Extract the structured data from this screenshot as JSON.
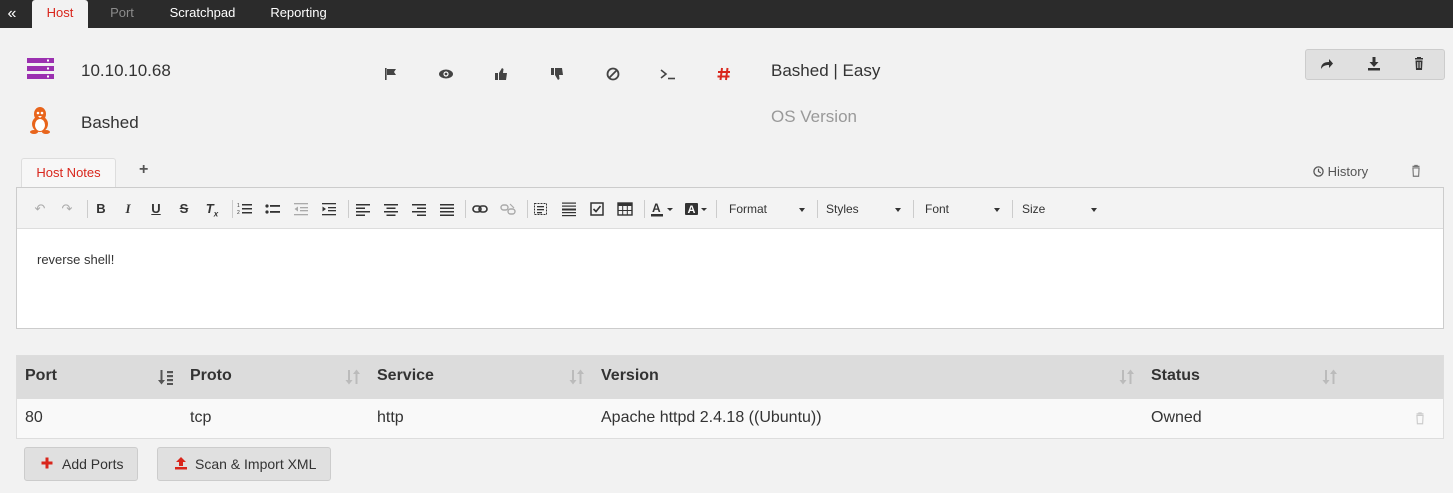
{
  "nav": {
    "back_label": "«",
    "tabs": [
      {
        "label": "Host",
        "active": true
      },
      {
        "label": "Port",
        "active": false
      },
      {
        "label": "Scratchpad",
        "active": false
      },
      {
        "label": "Reporting",
        "active": false
      }
    ]
  },
  "host": {
    "ip": "10.10.10.68",
    "hostname": "Bashed",
    "title": "Bashed | Easy",
    "os_version_placeholder": "OS Version",
    "os": "linux"
  },
  "toolbar_icons": [
    "flag-icon",
    "eye-icon",
    "thumbs-up-icon",
    "thumbs-down-icon",
    "ban-icon",
    "terminal-icon",
    "hashtag-icon"
  ],
  "actions": [
    "share-icon",
    "download-icon",
    "trash-icon"
  ],
  "notes": {
    "tab_label": "Host Notes",
    "add_label": "+",
    "history_label": "History",
    "content": "reverse shell!",
    "format_label": "Format",
    "styles_label": "Styles",
    "font_label": "Font",
    "size_label": "Size"
  },
  "ports_table": {
    "columns": [
      "Port",
      "Proto",
      "Service",
      "Version",
      "Status"
    ],
    "rows": [
      {
        "port": "80",
        "proto": "tcp",
        "service": "http",
        "version": "Apache httpd 2.4.18 ((Ubuntu))",
        "status": "Owned"
      }
    ]
  },
  "buttons": {
    "add_ports": "Add Ports",
    "scan_import": "Scan & Import XML"
  },
  "colors": {
    "accent": "#d9261c",
    "server_icon": "#9b30b0",
    "linux_icon": "#e8641b",
    "topbar": "#2b2b2b"
  }
}
